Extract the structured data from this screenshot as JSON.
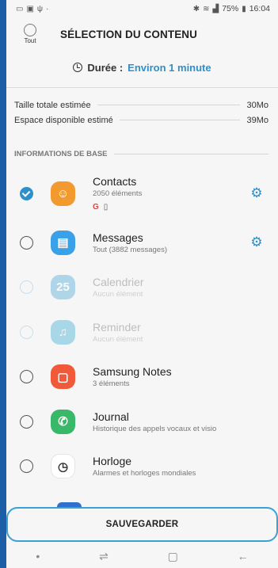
{
  "status_bar": {
    "left_icons": [
      "gallery-icon",
      "image-icon",
      "notification-icon"
    ],
    "right_text": "75%",
    "time": "16:04"
  },
  "header": {
    "select_all_label": "Tout",
    "title": "SÉLECTION DU CONTENU"
  },
  "duration": {
    "label": "Durée :",
    "value": "Environ 1 minute"
  },
  "sizes": [
    {
      "label": "Taille totale estimée",
      "value": "30Mo"
    },
    {
      "label": "Espace disponible estimé",
      "value": "39Mo"
    }
  ],
  "section": {
    "title": "INFORMATIONS DE BASE"
  },
  "items": [
    {
      "name": "Contacts",
      "sub": "2050 éléments",
      "checked": true,
      "enabled": true,
      "icon": "contact-icon",
      "color": "#f39a2e",
      "settings": true,
      "badges": [
        "G",
        "▯"
      ]
    },
    {
      "name": "Messages",
      "sub": "Tout (3882 messages)",
      "checked": false,
      "enabled": true,
      "icon": "messages-icon",
      "color": "#3aa0e8",
      "settings": true
    },
    {
      "name": "Calendrier",
      "sub": "Aucun élément",
      "checked": false,
      "enabled": false,
      "icon": "calendar-icon",
      "color": "#5ab0d8",
      "settings": false
    },
    {
      "name": "Reminder",
      "sub": "Aucun élément",
      "checked": false,
      "enabled": false,
      "icon": "reminder-icon",
      "color": "#4bb3d8",
      "settings": false
    },
    {
      "name": "Samsung Notes",
      "sub": "3 éléments",
      "checked": false,
      "enabled": true,
      "icon": "notes-icon",
      "color": "#f05a3a",
      "settings": false
    },
    {
      "name": "Journal",
      "sub": "Historique des appels vocaux et visio",
      "checked": false,
      "enabled": true,
      "icon": "phone-icon",
      "color": "#3ab86a",
      "settings": false
    },
    {
      "name": "Horloge",
      "sub": "Alarmes et horloges mondiales",
      "checked": false,
      "enabled": true,
      "icon": "clock-icon",
      "color": "#ffffff",
      "settings": false
    }
  ],
  "save_label": "SAUVEGARDER",
  "colors": {
    "accent": "#2f8fc9",
    "background": "#f6f6f6",
    "frame": "#1d5fa6"
  }
}
